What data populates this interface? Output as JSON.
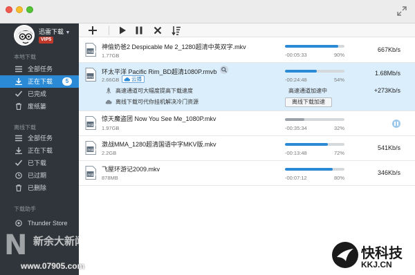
{
  "user": {
    "name": "迅雷下载",
    "vip": "VIP5"
  },
  "sidebar": {
    "local_section": "本地下载",
    "local_items": [
      {
        "label": "全部任务",
        "icon": "list-icon"
      },
      {
        "label": "正在下载",
        "icon": "download-arrow-icon",
        "badge": "5",
        "active": true
      },
      {
        "label": "已完成",
        "icon": "check-icon"
      },
      {
        "label": "废纸篓",
        "icon": "trash-icon"
      }
    ],
    "offline_section": "离线下载",
    "offline_items": [
      {
        "label": "全部任务",
        "icon": "list-icon"
      },
      {
        "label": "正在下载",
        "icon": "download-arrow-icon"
      },
      {
        "label": "已下载",
        "icon": "check-icon"
      },
      {
        "label": "已过期",
        "icon": "clock-icon"
      },
      {
        "label": "已删除",
        "icon": "trash-icon"
      }
    ],
    "helper_section": "下载助手",
    "helper_items": [
      {
        "label": "Thunder Store",
        "icon": "store-icon"
      }
    ]
  },
  "toolbar": {
    "actions": [
      "add-icon",
      "play-icon",
      "pause-icon",
      "delete-icon",
      "sort-icon"
    ]
  },
  "tasks": [
    {
      "name": "神偷奶爸2 Despicable Me 2_1280超清中英双字.mkv",
      "size": "1.77GB",
      "time": "-00:05:33",
      "percent": "90%",
      "progress": 0.9,
      "speed": "667Kb/s"
    },
    {
      "name": "环太平洋 Pacific Rim_BD超清1080P.rmvb",
      "size": "2.66GB",
      "time": "-00:24:48",
      "percent": "54%",
      "progress": 0.54,
      "speed": "1.68Mb/s",
      "cloud_tag": "云播",
      "accel_tip1": "高速通道可大幅度提高下载速度",
      "accel_tip2": "离线下载可代你挂机解决冷门资源",
      "accel_status": "高速通道加速中",
      "accel_speed": "+273Kb/s",
      "accel_button": "离线下载加速"
    },
    {
      "name": "惊天魔盗团 Now You See Me_1080P.mkv",
      "size": "1.97GB",
      "time": "-00:35:34",
      "percent": "32%",
      "progress": 0.32,
      "speed": ""
    },
    {
      "name": "激战MMA_1280超清国语中字MKV版.mkv",
      "size": "2.2GB",
      "time": "-00:13:48",
      "percent": "72%",
      "progress": 0.72,
      "speed": "541Kb/s"
    },
    {
      "name": "飞屋环游记2009.mkv",
      "size": "878MB",
      "time": "-00:07:12",
      "percent": "80%",
      "progress": 0.8,
      "speed": "346Kb/s"
    }
  ],
  "watermark_left": {
    "brand": "N",
    "cn": "新余大新闻",
    "site": "www.07905.com"
  },
  "watermark_right": {
    "cn": "快科技",
    "site": "KKJ.CN"
  }
}
